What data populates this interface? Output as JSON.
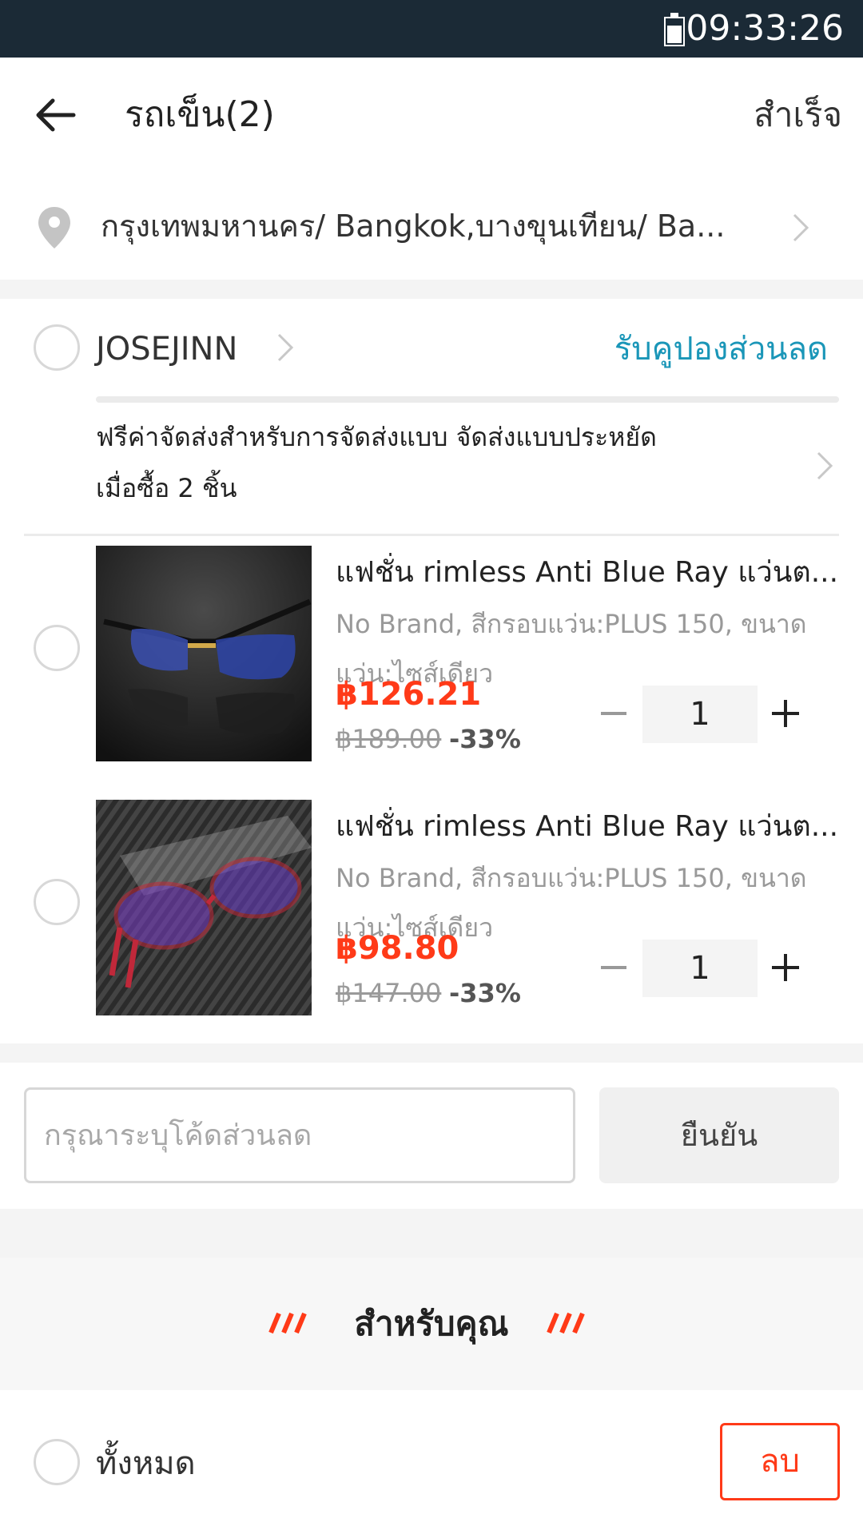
{
  "status_bar": {
    "time": "09:33:26"
  },
  "header": {
    "title": "รถเข็น(2)",
    "done_label": "สำเร็จ"
  },
  "address": {
    "text": "กรุงเทพมหานคร/ Bangkok,บางขุนเทียน/ Ba..."
  },
  "store": {
    "name": "JOSEJINN",
    "coupon_link": "รับคูปองส่วนลด",
    "shipping_line1": "ฟรีค่าจัดส่งสำหรับการจัดส่งแบบ จัดส่งแบบประหยัด",
    "shipping_line2": "เมื่อซื้อ 2 ชิ้น"
  },
  "items": [
    {
      "title": "แฟชั่น rimless Anti Blue Ray แว่นต...",
      "sku": "No Brand, สีกรอบแว่น:PLUS 150, ขนาดแว่น:ไซส์เดียว",
      "price": "฿126.21",
      "original_price": "฿189.00",
      "discount": "-33%",
      "quantity": "1"
    },
    {
      "title": "แฟชั่น rimless Anti Blue Ray แว่นต...",
      "sku": "No Brand, สีกรอบแว่น:PLUS 150, ขนาดแว่น:ไซส์เดียว",
      "price": "฿98.80",
      "original_price": "฿147.00",
      "discount": "-33%",
      "quantity": "1"
    }
  ],
  "voucher": {
    "placeholder": "กรุณาระบุโค้ดส่วนลด",
    "confirm_label": "ยืนยัน"
  },
  "for_you": {
    "title": "สำหรับคุณ"
  },
  "bottom_bar": {
    "select_all_label": "ทั้งหมด",
    "delete_label": "ลบ"
  },
  "colors": {
    "status_bar_bg": "#1b2a36",
    "price_red": "#ff3a18",
    "link_teal": "#1a96b8"
  }
}
